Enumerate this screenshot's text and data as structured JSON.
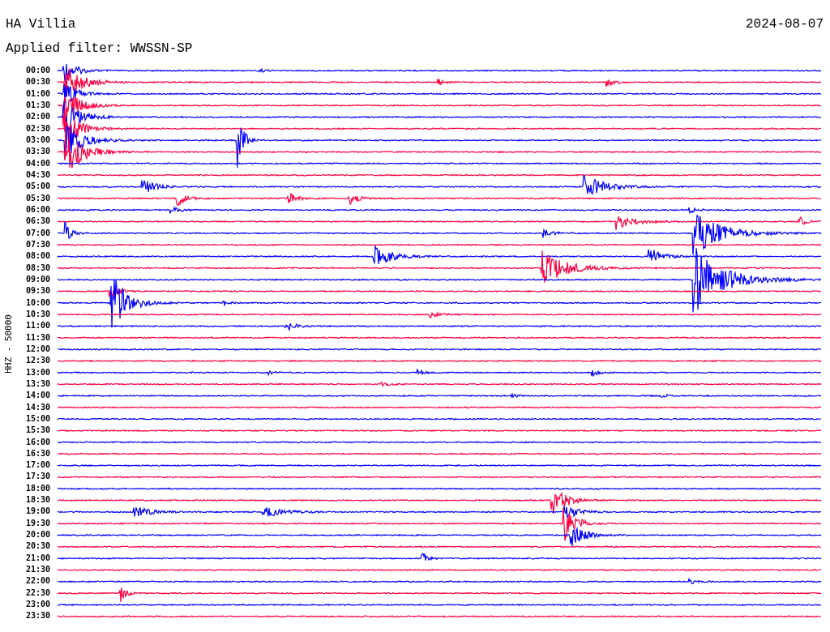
{
  "station": "HA Villia",
  "date": "2024-08-07",
  "filter_text": "Applied filter: WWSSN-SP",
  "axis_label": "HHZ - 50000",
  "traces": [
    {
      "time": "00:00",
      "color": "#0000ff"
    },
    {
      "time": "00:30",
      "color": "#ff0040"
    },
    {
      "time": "01:00",
      "color": "#0000ff"
    },
    {
      "time": "01:30",
      "color": "#ff0040"
    },
    {
      "time": "02:00",
      "color": "#0000ff"
    },
    {
      "time": "02:30",
      "color": "#ff0040"
    },
    {
      "time": "03:00",
      "color": "#0000ff"
    },
    {
      "time": "03:30",
      "color": "#ff0040"
    },
    {
      "time": "04:00",
      "color": "#0000ff"
    },
    {
      "time": "04:30",
      "color": "#ff0040"
    },
    {
      "time": "05:00",
      "color": "#0000ff"
    },
    {
      "time": "05:30",
      "color": "#ff0040"
    },
    {
      "time": "06:00",
      "color": "#0000ff"
    },
    {
      "time": "06:30",
      "color": "#ff0040"
    },
    {
      "time": "07:00",
      "color": "#0000ff"
    },
    {
      "time": "07:30",
      "color": "#ff0040"
    },
    {
      "time": "08:00",
      "color": "#0000ff"
    },
    {
      "time": "08:30",
      "color": "#ff0040"
    },
    {
      "time": "09:00",
      "color": "#0000ff"
    },
    {
      "time": "09:30",
      "color": "#ff0040"
    },
    {
      "time": "10:00",
      "color": "#0000ff"
    },
    {
      "time": "10:30",
      "color": "#ff0040"
    },
    {
      "time": "11:00",
      "color": "#0000ff"
    },
    {
      "time": "11:30",
      "color": "#ff0040"
    },
    {
      "time": "12:00",
      "color": "#0000ff"
    },
    {
      "time": "12:30",
      "color": "#ff0040"
    },
    {
      "time": "13:00",
      "color": "#0000ff"
    },
    {
      "time": "13:30",
      "color": "#ff0040"
    },
    {
      "time": "14:00",
      "color": "#0000ff"
    },
    {
      "time": "14:30",
      "color": "#ff0040"
    },
    {
      "time": "15:00",
      "color": "#0000ff"
    },
    {
      "time": "15:30",
      "color": "#ff0040"
    },
    {
      "time": "16:00",
      "color": "#0000ff"
    },
    {
      "time": "16:30",
      "color": "#ff0040"
    },
    {
      "time": "17:00",
      "color": "#0000ff"
    },
    {
      "time": "17:30",
      "color": "#ff0040"
    },
    {
      "time": "18:00",
      "color": "#0000ff"
    },
    {
      "time": "18:30",
      "color": "#ff0040"
    },
    {
      "time": "19:00",
      "color": "#0000ff"
    },
    {
      "time": "19:30",
      "color": "#ff0040"
    },
    {
      "time": "20:00",
      "color": "#0000ff"
    },
    {
      "time": "20:30",
      "color": "#ff0040"
    },
    {
      "time": "21:00",
      "color": "#0000ff"
    },
    {
      "time": "21:30",
      "color": "#ff0040"
    },
    {
      "time": "22:00",
      "color": "#0000ff"
    },
    {
      "time": "22:30",
      "color": "#ff0040"
    },
    {
      "time": "23:00",
      "color": "#0000ff"
    },
    {
      "time": "23:30",
      "color": "#ff0040"
    }
  ]
}
